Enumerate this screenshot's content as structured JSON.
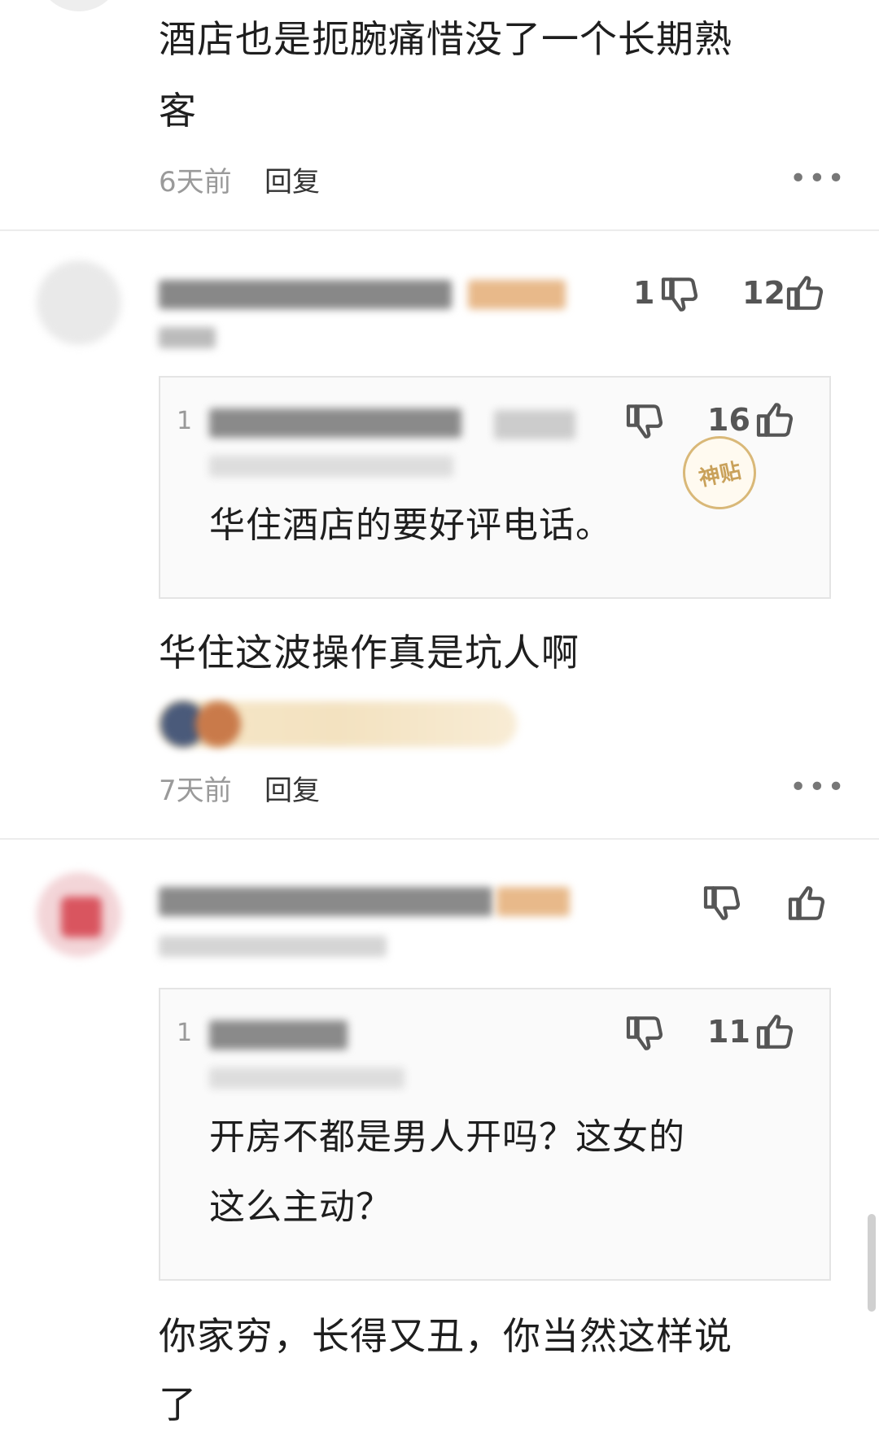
{
  "comments": [
    {
      "body_line1": "酒店也是扼腕痛惜没了一个长期熟",
      "body_line2": "客",
      "time": "6天前",
      "reply": "回复",
      "more": "•••"
    },
    {
      "dislike_count": "1",
      "like_count": "12",
      "quote": {
        "index": "1",
        "dislike_count": "",
        "like_count": "16",
        "badge": "神贴",
        "text": "华住酒店的要好评电话。"
      },
      "body": "华住这波操作真是坑人啊",
      "time": "7天前",
      "reply": "回复",
      "more": "•••"
    },
    {
      "dislike_count": "",
      "like_count": "",
      "quote": {
        "index": "1",
        "like_count": "11",
        "text_line1": "开房不都是男人开吗？这女的",
        "text_line2": "这么主动？"
      },
      "body_line1": "你家穷，长得又丑，你当然这样说",
      "body_line2": "了"
    }
  ],
  "icons": {
    "thumb_up": "thumb-up-icon",
    "thumb_down": "thumb-down-icon"
  },
  "colors": {
    "text": "#1e1e1e",
    "muted": "#9a9a9a",
    "badge": "#c9a15a"
  }
}
